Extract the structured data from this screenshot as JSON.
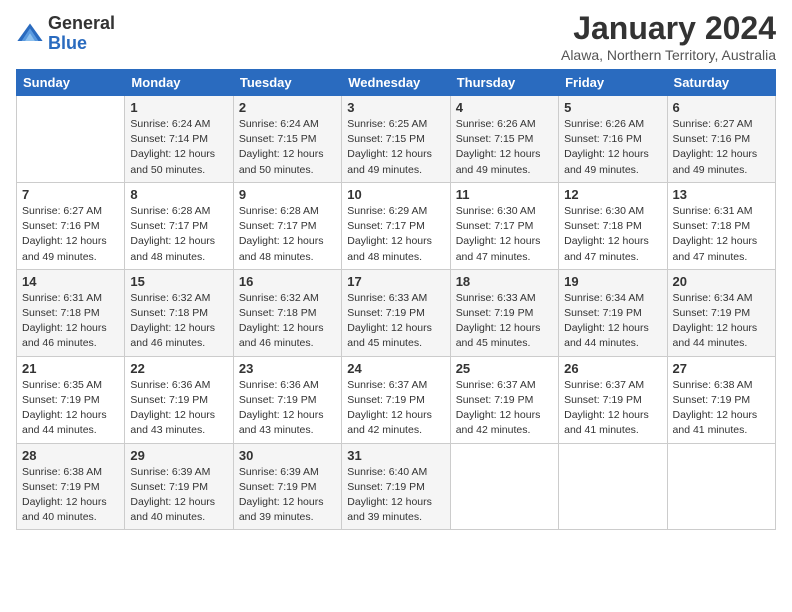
{
  "logo": {
    "general": "General",
    "blue": "Blue"
  },
  "title": {
    "month_year": "January 2024",
    "location": "Alawa, Northern Territory, Australia"
  },
  "days_of_week": [
    "Sunday",
    "Monday",
    "Tuesday",
    "Wednesday",
    "Thursday",
    "Friday",
    "Saturday"
  ],
  "weeks": [
    [
      {
        "day": "",
        "sunrise": "",
        "sunset": "",
        "daylight": ""
      },
      {
        "day": "1",
        "sunrise": "Sunrise: 6:24 AM",
        "sunset": "Sunset: 7:14 PM",
        "daylight": "Daylight: 12 hours and 50 minutes."
      },
      {
        "day": "2",
        "sunrise": "Sunrise: 6:24 AM",
        "sunset": "Sunset: 7:15 PM",
        "daylight": "Daylight: 12 hours and 50 minutes."
      },
      {
        "day": "3",
        "sunrise": "Sunrise: 6:25 AM",
        "sunset": "Sunset: 7:15 PM",
        "daylight": "Daylight: 12 hours and 49 minutes."
      },
      {
        "day": "4",
        "sunrise": "Sunrise: 6:26 AM",
        "sunset": "Sunset: 7:15 PM",
        "daylight": "Daylight: 12 hours and 49 minutes."
      },
      {
        "day": "5",
        "sunrise": "Sunrise: 6:26 AM",
        "sunset": "Sunset: 7:16 PM",
        "daylight": "Daylight: 12 hours and 49 minutes."
      },
      {
        "day": "6",
        "sunrise": "Sunrise: 6:27 AM",
        "sunset": "Sunset: 7:16 PM",
        "daylight": "Daylight: 12 hours and 49 minutes."
      }
    ],
    [
      {
        "day": "7",
        "sunrise": "Sunrise: 6:27 AM",
        "sunset": "Sunset: 7:16 PM",
        "daylight": "Daylight: 12 hours and 49 minutes."
      },
      {
        "day": "8",
        "sunrise": "Sunrise: 6:28 AM",
        "sunset": "Sunset: 7:17 PM",
        "daylight": "Daylight: 12 hours and 48 minutes."
      },
      {
        "day": "9",
        "sunrise": "Sunrise: 6:28 AM",
        "sunset": "Sunset: 7:17 PM",
        "daylight": "Daylight: 12 hours and 48 minutes."
      },
      {
        "day": "10",
        "sunrise": "Sunrise: 6:29 AM",
        "sunset": "Sunset: 7:17 PM",
        "daylight": "Daylight: 12 hours and 48 minutes."
      },
      {
        "day": "11",
        "sunrise": "Sunrise: 6:30 AM",
        "sunset": "Sunset: 7:17 PM",
        "daylight": "Daylight: 12 hours and 47 minutes."
      },
      {
        "day": "12",
        "sunrise": "Sunrise: 6:30 AM",
        "sunset": "Sunset: 7:18 PM",
        "daylight": "Daylight: 12 hours and 47 minutes."
      },
      {
        "day": "13",
        "sunrise": "Sunrise: 6:31 AM",
        "sunset": "Sunset: 7:18 PM",
        "daylight": "Daylight: 12 hours and 47 minutes."
      }
    ],
    [
      {
        "day": "14",
        "sunrise": "Sunrise: 6:31 AM",
        "sunset": "Sunset: 7:18 PM",
        "daylight": "Daylight: 12 hours and 46 minutes."
      },
      {
        "day": "15",
        "sunrise": "Sunrise: 6:32 AM",
        "sunset": "Sunset: 7:18 PM",
        "daylight": "Daylight: 12 hours and 46 minutes."
      },
      {
        "day": "16",
        "sunrise": "Sunrise: 6:32 AM",
        "sunset": "Sunset: 7:18 PM",
        "daylight": "Daylight: 12 hours and 46 minutes."
      },
      {
        "day": "17",
        "sunrise": "Sunrise: 6:33 AM",
        "sunset": "Sunset: 7:19 PM",
        "daylight": "Daylight: 12 hours and 45 minutes."
      },
      {
        "day": "18",
        "sunrise": "Sunrise: 6:33 AM",
        "sunset": "Sunset: 7:19 PM",
        "daylight": "Daylight: 12 hours and 45 minutes."
      },
      {
        "day": "19",
        "sunrise": "Sunrise: 6:34 AM",
        "sunset": "Sunset: 7:19 PM",
        "daylight": "Daylight: 12 hours and 44 minutes."
      },
      {
        "day": "20",
        "sunrise": "Sunrise: 6:34 AM",
        "sunset": "Sunset: 7:19 PM",
        "daylight": "Daylight: 12 hours and 44 minutes."
      }
    ],
    [
      {
        "day": "21",
        "sunrise": "Sunrise: 6:35 AM",
        "sunset": "Sunset: 7:19 PM",
        "daylight": "Daylight: 12 hours and 44 minutes."
      },
      {
        "day": "22",
        "sunrise": "Sunrise: 6:36 AM",
        "sunset": "Sunset: 7:19 PM",
        "daylight": "Daylight: 12 hours and 43 minutes."
      },
      {
        "day": "23",
        "sunrise": "Sunrise: 6:36 AM",
        "sunset": "Sunset: 7:19 PM",
        "daylight": "Daylight: 12 hours and 43 minutes."
      },
      {
        "day": "24",
        "sunrise": "Sunrise: 6:37 AM",
        "sunset": "Sunset: 7:19 PM",
        "daylight": "Daylight: 12 hours and 42 minutes."
      },
      {
        "day": "25",
        "sunrise": "Sunrise: 6:37 AM",
        "sunset": "Sunset: 7:19 PM",
        "daylight": "Daylight: 12 hours and 42 minutes."
      },
      {
        "day": "26",
        "sunrise": "Sunrise: 6:37 AM",
        "sunset": "Sunset: 7:19 PM",
        "daylight": "Daylight: 12 hours and 41 minutes."
      },
      {
        "day": "27",
        "sunrise": "Sunrise: 6:38 AM",
        "sunset": "Sunset: 7:19 PM",
        "daylight": "Daylight: 12 hours and 41 minutes."
      }
    ],
    [
      {
        "day": "28",
        "sunrise": "Sunrise: 6:38 AM",
        "sunset": "Sunset: 7:19 PM",
        "daylight": "Daylight: 12 hours and 40 minutes."
      },
      {
        "day": "29",
        "sunrise": "Sunrise: 6:39 AM",
        "sunset": "Sunset: 7:19 PM",
        "daylight": "Daylight: 12 hours and 40 minutes."
      },
      {
        "day": "30",
        "sunrise": "Sunrise: 6:39 AM",
        "sunset": "Sunset: 7:19 PM",
        "daylight": "Daylight: 12 hours and 39 minutes."
      },
      {
        "day": "31",
        "sunrise": "Sunrise: 6:40 AM",
        "sunset": "Sunset: 7:19 PM",
        "daylight": "Daylight: 12 hours and 39 minutes."
      },
      {
        "day": "",
        "sunrise": "",
        "sunset": "",
        "daylight": ""
      },
      {
        "day": "",
        "sunrise": "",
        "sunset": "",
        "daylight": ""
      },
      {
        "day": "",
        "sunrise": "",
        "sunset": "",
        "daylight": ""
      }
    ]
  ]
}
